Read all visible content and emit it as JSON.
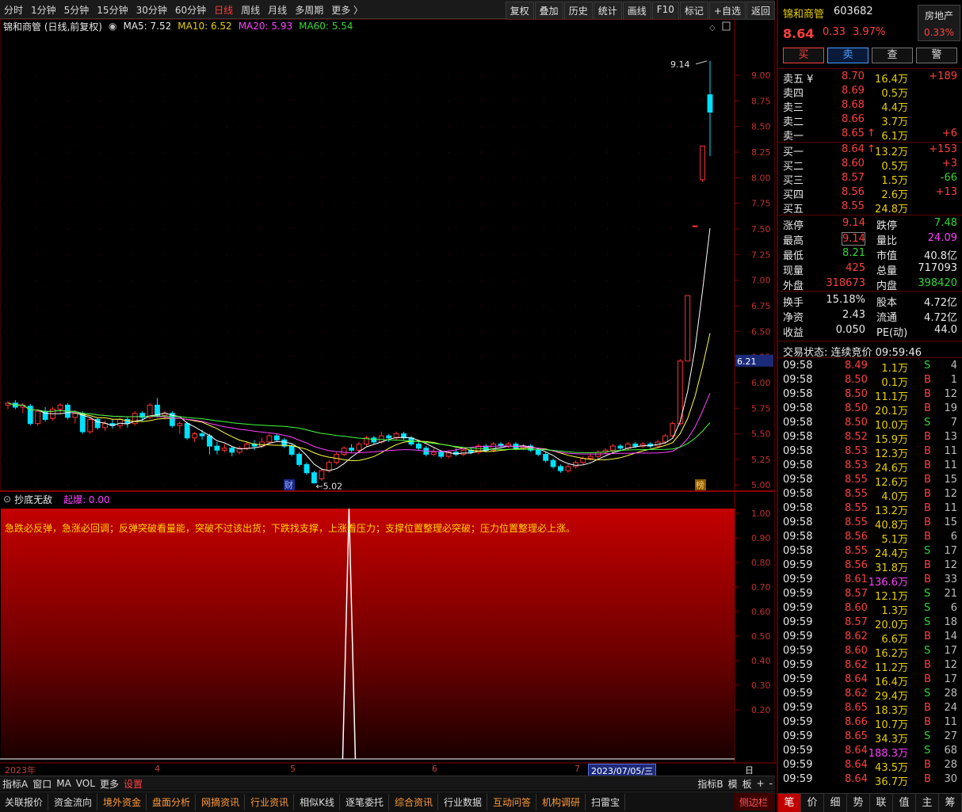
{
  "periods": [
    "分时",
    "1分钟",
    "5分钟",
    "15分钟",
    "30分钟",
    "60分钟",
    "日线",
    "周线",
    "月线",
    "多周期",
    "更多 〉"
  ],
  "active_period": "日线",
  "tools": [
    "复权",
    "叠加",
    "历史",
    "统计",
    "画线",
    "F10",
    "标记",
    "+自选",
    "返回"
  ],
  "legend": {
    "title": "锦和商管 (日线,前复权)",
    "ma5": "MA5: 7.52",
    "ma10": "MA10: 6.52",
    "ma20": "MA20: 5.93",
    "ma60": "MA60: 5.54"
  },
  "colors": {
    "up": "#ff3232",
    "down": "#00e0ff",
    "ma5": "#ffffff",
    "ma10": "#ffff40",
    "ma20": "#ff40ff",
    "ma60": "#40ff40",
    "grid": "#8a0000"
  },
  "chart_data": {
    "type": "candlestick",
    "price_axis": [
      "9.00",
      "8.75",
      "8.50",
      "8.25",
      "8.00",
      "7.75",
      "7.50",
      "7.25",
      "7.00",
      "6.75",
      "6.50",
      "6.25",
      "6.00",
      "5.75",
      "5.50",
      "5.25",
      "5.00"
    ],
    "price_ylim": [
      4.94,
      9.24
    ],
    "current_price_tag": "6.21",
    "high_label": "9.14",
    "low_label": "5.02",
    "markers": [
      "财",
      "榜"
    ],
    "candles": [
      [
        5.78,
        5.8,
        5.74,
        5.82
      ],
      [
        5.8,
        5.76,
        5.74,
        5.83
      ],
      [
        5.76,
        5.78,
        5.7,
        5.8
      ],
      [
        5.77,
        5.6,
        5.58,
        5.79
      ],
      [
        5.6,
        5.72,
        5.58,
        5.74
      ],
      [
        5.72,
        5.64,
        5.62,
        5.76
      ],
      [
        5.65,
        5.74,
        5.63,
        5.76
      ],
      [
        5.74,
        5.78,
        5.7,
        5.8
      ],
      [
        5.78,
        5.66,
        5.64,
        5.8
      ],
      [
        5.66,
        5.7,
        5.6,
        5.73
      ],
      [
        5.7,
        5.52,
        5.5,
        5.72
      ],
      [
        5.52,
        5.64,
        5.5,
        5.66
      ],
      [
        5.64,
        5.56,
        5.54,
        5.66
      ],
      [
        5.56,
        5.6,
        5.53,
        5.63
      ],
      [
        5.6,
        5.58,
        5.55,
        5.64
      ],
      [
        5.58,
        5.64,
        5.55,
        5.66
      ],
      [
        5.64,
        5.6,
        5.56,
        5.66
      ],
      [
        5.6,
        5.7,
        5.58,
        5.72
      ],
      [
        5.7,
        5.66,
        5.62,
        5.72
      ],
      [
        5.66,
        5.78,
        5.64,
        5.8
      ],
      [
        5.78,
        5.68,
        5.66,
        5.85
      ],
      [
        5.68,
        5.7,
        5.64,
        5.72
      ],
      [
        5.7,
        5.58,
        5.56,
        5.72
      ],
      [
        5.58,
        5.6,
        5.5,
        5.62
      ],
      [
        5.6,
        5.46,
        5.44,
        5.62
      ],
      [
        5.46,
        5.5,
        5.42,
        5.52
      ],
      [
        5.5,
        5.48,
        5.44,
        5.54
      ],
      [
        5.48,
        5.38,
        5.3,
        5.5
      ],
      [
        5.38,
        5.34,
        5.3,
        5.42
      ],
      [
        5.34,
        5.36,
        5.32,
        5.4
      ],
      [
        5.36,
        5.32,
        5.28,
        5.38
      ],
      [
        5.32,
        5.36,
        5.3,
        5.38
      ],
      [
        5.36,
        5.4,
        5.34,
        5.42
      ],
      [
        5.4,
        5.38,
        5.34,
        5.44
      ],
      [
        5.38,
        5.42,
        5.36,
        5.46
      ],
      [
        5.42,
        5.48,
        5.4,
        5.5
      ],
      [
        5.48,
        5.44,
        5.42,
        5.5
      ],
      [
        5.44,
        5.38,
        5.36,
        5.46
      ],
      [
        5.38,
        5.3,
        5.28,
        5.4
      ],
      [
        5.3,
        5.2,
        5.18,
        5.32
      ],
      [
        5.2,
        5.12,
        5.1,
        5.22
      ],
      [
        5.12,
        5.02,
        5.02,
        5.14
      ],
      [
        5.06,
        5.14,
        5.04,
        5.16
      ],
      [
        5.14,
        5.22,
        5.12,
        5.24
      ],
      [
        5.22,
        5.3,
        5.2,
        5.32
      ],
      [
        5.3,
        5.36,
        5.28,
        5.38
      ],
      [
        5.36,
        5.34,
        5.32,
        5.4
      ],
      [
        5.34,
        5.4,
        5.32,
        5.42
      ],
      [
        5.4,
        5.46,
        5.38,
        5.48
      ],
      [
        5.46,
        5.42,
        5.4,
        5.48
      ],
      [
        5.42,
        5.48,
        5.4,
        5.52
      ],
      [
        5.48,
        5.46,
        5.42,
        5.5
      ],
      [
        5.46,
        5.5,
        5.44,
        5.52
      ],
      [
        5.5,
        5.46,
        5.44,
        5.52
      ],
      [
        5.46,
        5.4,
        5.38,
        5.48
      ],
      [
        5.4,
        5.36,
        5.34,
        5.42
      ],
      [
        5.36,
        5.3,
        5.28,
        5.38
      ],
      [
        5.3,
        5.32,
        5.28,
        5.36
      ],
      [
        5.32,
        5.28,
        5.26,
        5.34
      ],
      [
        5.28,
        5.32,
        5.26,
        5.34
      ],
      [
        5.32,
        5.3,
        5.28,
        5.36
      ],
      [
        5.3,
        5.34,
        5.28,
        5.36
      ],
      [
        5.34,
        5.32,
        5.3,
        5.36
      ],
      [
        5.32,
        5.38,
        5.3,
        5.4
      ],
      [
        5.38,
        5.34,
        5.32,
        5.4
      ],
      [
        5.34,
        5.4,
        5.32,
        5.42
      ],
      [
        5.4,
        5.38,
        5.36,
        5.42
      ],
      [
        5.38,
        5.4,
        5.36,
        5.42
      ],
      [
        5.4,
        5.36,
        5.34,
        5.42
      ],
      [
        5.36,
        5.38,
        5.34,
        5.4
      ],
      [
        5.38,
        5.34,
        5.32,
        5.4
      ],
      [
        5.34,
        5.3,
        5.28,
        5.36
      ],
      [
        5.3,
        5.24,
        5.22,
        5.32
      ],
      [
        5.24,
        5.18,
        5.16,
        5.26
      ],
      [
        5.18,
        5.14,
        5.12,
        5.2
      ],
      [
        5.14,
        5.18,
        5.12,
        5.2
      ],
      [
        5.18,
        5.22,
        5.16,
        5.24
      ],
      [
        5.22,
        5.26,
        5.2,
        5.28
      ],
      [
        5.26,
        5.28,
        5.24,
        5.3
      ],
      [
        5.28,
        5.32,
        5.26,
        5.34
      ],
      [
        5.32,
        5.34,
        5.3,
        5.36
      ],
      [
        5.34,
        5.38,
        5.32,
        5.4
      ],
      [
        5.38,
        5.36,
        5.34,
        5.4
      ],
      [
        5.36,
        5.4,
        5.34,
        5.42
      ],
      [
        5.4,
        5.38,
        5.36,
        5.42
      ],
      [
        5.38,
        5.4,
        5.36,
        5.42
      ],
      [
        5.4,
        5.38,
        5.36,
        5.42
      ],
      [
        5.38,
        5.42,
        5.36,
        5.44
      ],
      [
        5.42,
        5.48,
        5.4,
        5.5
      ],
      [
        5.48,
        5.6,
        5.46,
        5.62
      ],
      [
        5.6,
        6.21,
        5.58,
        6.23
      ],
      [
        6.21,
        6.85,
        6.85,
        6.85
      ],
      [
        7.53,
        7.53,
        7.53,
        7.53
      ],
      [
        7.98,
        8.31,
        7.96,
        8.31
      ],
      [
        8.81,
        8.64,
        8.21,
        9.14
      ]
    ]
  },
  "indicator": {
    "name": "抄底无敌",
    "param": "起爆: 0.00",
    "axis": [
      "1.00",
      "0.90",
      "0.80",
      "0.70",
      "0.60",
      "0.50",
      "0.40",
      "0.30",
      "0.20"
    ],
    "slogan": "急跌必反弹，急涨必回调；反弹突破看量能，突破不过该出货；下跌找支撑，上涨看压力；支撑位置整理必突破；压力位置整理必上涨。"
  },
  "dates": {
    "start": "2023年",
    "m4": "4",
    "m5": "5",
    "m6": "6",
    "m7": "7",
    "cursor": "2023/07/05/三",
    "period": "日线"
  },
  "bottombar": {
    "left": [
      "指标A",
      "窗口",
      "MA",
      "VOL",
      "更多",
      "设置"
    ],
    "right": [
      "指标B",
      "模",
      "板",
      "+",
      "-"
    ]
  },
  "tabs": [
    "关联报价",
    "资金流向",
    "境外资金",
    "盘面分析",
    "网摘资讯",
    "行业资讯",
    "相似K线",
    "逐笔委托",
    "综合资讯",
    "行业数据",
    "互动问答",
    "机构调研",
    "扫雷宝"
  ],
  "sidebar_btn": "侧边栏",
  "quote": {
    "name": "锦和商管",
    "code": "603682",
    "sector": "房地产",
    "sector_pct": "0.33%",
    "price": "8.64",
    "chg": "0.33",
    "pct": "3.97%",
    "buttons": [
      "买",
      "卖",
      "查",
      "警"
    ],
    "asks": [
      {
        "label": "卖五 ¥",
        "price": "8.70",
        "vol": "16.4万",
        "delta": "+189"
      },
      {
        "label": "卖四",
        "price": "8.69",
        "vol": "0.5万",
        "delta": ""
      },
      {
        "label": "卖三",
        "price": "8.68",
        "vol": "4.4万",
        "delta": ""
      },
      {
        "label": "卖二",
        "price": "8.66",
        "vol": "3.7万",
        "delta": ""
      },
      {
        "label": "卖一",
        "price": "8.65",
        "vol": "6.1万",
        "delta": "+6"
      }
    ],
    "bids": [
      {
        "label": "买一",
        "price": "8.64",
        "vol": "13.2万",
        "delta": "+153"
      },
      {
        "label": "买二",
        "price": "8.60",
        "vol": "0.5万",
        "delta": "+3"
      },
      {
        "label": "买三",
        "price": "8.57",
        "vol": "1.5万",
        "delta": "-66"
      },
      {
        "label": "买四",
        "price": "8.56",
        "vol": "2.6万",
        "delta": "+13"
      },
      {
        "label": "买五",
        "price": "8.55",
        "vol": "24.8万",
        "delta": ""
      }
    ],
    "stats": [
      {
        "k1": "涨停",
        "v1": "9.14",
        "k2": "跌停",
        "v2": "7.48"
      },
      {
        "k1": "最高",
        "v1": "9.14",
        "k2": "量比",
        "v2": "24.09"
      },
      {
        "k1": "最低",
        "v1": "8.21",
        "k2": "市值",
        "v2": "40.8亿"
      },
      {
        "k1": "现量",
        "v1": "425",
        "k2": "总量",
        "v2": "717093"
      },
      {
        "k1": "外盘",
        "v1": "318673",
        "k2": "内盘",
        "v2": "398420"
      }
    ],
    "stats2": [
      {
        "k1": "换手",
        "v1": "15.18%",
        "k2": "股本",
        "v2": "4.72亿"
      },
      {
        "k1": "净资",
        "v1": "2.43",
        "k2": "流通",
        "v2": "4.72亿"
      },
      {
        "k1": "收益",
        "v1": "0.050",
        "k2": "PE(动)",
        "v2": "44.0"
      }
    ],
    "status": "交易状态: 连续竞价 09:59:46",
    "ticks": [
      [
        "09:58",
        "8.49",
        "1.1万",
        "S",
        "4"
      ],
      [
        "09:58",
        "8.50",
        "0.1万",
        "B",
        "1"
      ],
      [
        "09:58",
        "8.50",
        "11.1万",
        "B",
        "12"
      ],
      [
        "09:58",
        "8.50",
        "20.1万",
        "B",
        "19"
      ],
      [
        "09:58",
        "8.50",
        "10.0万",
        "S",
        "7"
      ],
      [
        "09:58",
        "8.52",
        "15.9万",
        "B",
        "13"
      ],
      [
        "09:58",
        "8.53",
        "12.3万",
        "B",
        "11"
      ],
      [
        "09:58",
        "8.53",
        "24.6万",
        "B",
        "11"
      ],
      [
        "09:58",
        "8.55",
        "12.6万",
        "B",
        "15"
      ],
      [
        "09:58",
        "8.55",
        "4.0万",
        "B",
        "12"
      ],
      [
        "09:58",
        "8.55",
        "13.2万",
        "B",
        "11"
      ],
      [
        "09:58",
        "8.55",
        "40.8万",
        "B",
        "15"
      ],
      [
        "09:58",
        "8.56",
        "5.1万",
        "B",
        "6"
      ],
      [
        "09:58",
        "8.55",
        "24.4万",
        "S",
        "17"
      ],
      [
        "09:59",
        "8.56",
        "31.8万",
        "B",
        "12"
      ],
      [
        "09:59",
        "8.61",
        "136.6万",
        "B",
        "33"
      ],
      [
        "09:59",
        "8.57",
        "12.1万",
        "S",
        "21"
      ],
      [
        "09:59",
        "8.60",
        "1.3万",
        "S",
        "6"
      ],
      [
        "09:59",
        "8.57",
        "20.0万",
        "S",
        "18"
      ],
      [
        "09:59",
        "8.62",
        "6.6万",
        "B",
        "14"
      ],
      [
        "09:59",
        "8.60",
        "16.2万",
        "S",
        "17"
      ],
      [
        "09:59",
        "8.62",
        "11.2万",
        "B",
        "12"
      ],
      [
        "09:59",
        "8.64",
        "16.4万",
        "B",
        "17"
      ],
      [
        "09:59",
        "8.62",
        "29.4万",
        "S",
        "28"
      ],
      [
        "09:59",
        "8.65",
        "18.3万",
        "B",
        "24"
      ],
      [
        "09:59",
        "8.66",
        "10.7万",
        "B",
        "11"
      ],
      [
        "09:59",
        "8.65",
        "34.3万",
        "S",
        "27"
      ],
      [
        "09:59",
        "8.64",
        "188.3万",
        "S",
        "68"
      ],
      [
        "09:59",
        "8.64",
        "43.5万",
        "B",
        "28"
      ],
      [
        "09:59",
        "8.64",
        "36.7万",
        "B",
        "30"
      ]
    ],
    "bottom_tabs": [
      "笔",
      "价",
      "细",
      "势",
      "联",
      "值",
      "主",
      "筹"
    ]
  }
}
